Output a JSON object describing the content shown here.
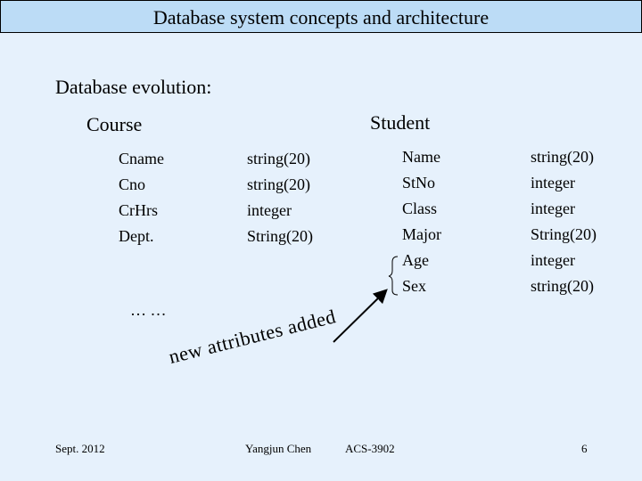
{
  "slide": {
    "title": "Database system concepts and architecture",
    "subtitle": "Database evolution:",
    "course": {
      "label": "Course",
      "rows": [
        {
          "attr": "Cname",
          "type": "string(20)"
        },
        {
          "attr": "Cno",
          "type": "string(20)"
        },
        {
          "attr": "CrHrs",
          "type": "integer"
        },
        {
          "attr": "Dept.",
          "type": "String(20)"
        }
      ]
    },
    "student": {
      "label": "Student",
      "rows": [
        {
          "attr": "Name",
          "type": "string(20)"
        },
        {
          "attr": "StNo",
          "type": "integer"
        },
        {
          "attr": "Class",
          "type": "integer"
        },
        {
          "attr": "Major",
          "type": "String(20)"
        },
        {
          "attr": "Age",
          "type": "integer"
        },
        {
          "attr": "Sex",
          "type": "string(20)"
        }
      ]
    },
    "ellipsis": "… …",
    "annotation": "new attributes added",
    "footer": {
      "date": "Sept. 2012",
      "author": "Yangjun Chen",
      "course_code": "ACS-3902",
      "page_number": "6"
    }
  }
}
